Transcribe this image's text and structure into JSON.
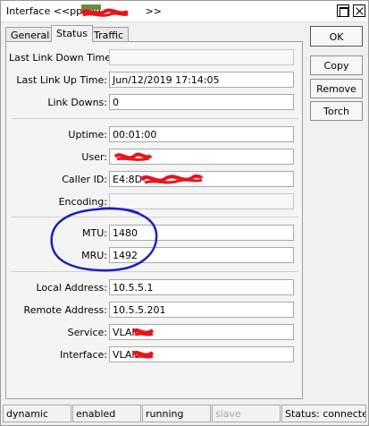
{
  "window": {
    "title": "Interface <<pppoe-",
    "title_suffix": ">>"
  },
  "tabs": [
    {
      "label": "General"
    },
    {
      "label": "Status"
    },
    {
      "label": "Traffic"
    }
  ],
  "fields": {
    "last_link_down_time": {
      "label": "Last Link Down Time:",
      "value": ""
    },
    "last_link_up_time": {
      "label": "Last Link Up Time:",
      "value": "Jun/12/2019 17:14:05"
    },
    "link_downs": {
      "label": "Link Downs:",
      "value": "0"
    },
    "uptime": {
      "label": "Uptime:",
      "value": "00:01:00"
    },
    "user": {
      "label": "User:",
      "value": ""
    },
    "caller_id": {
      "label": "Caller ID:",
      "value": "E4:8D-"
    },
    "encoding": {
      "label": "Encoding:",
      "value": ""
    },
    "mtu": {
      "label": "MTU:",
      "value": "1480"
    },
    "mru": {
      "label": "MRU:",
      "value": "1492"
    },
    "local_address": {
      "label": "Local Address:",
      "value": "10.5.5.1"
    },
    "remote_address": {
      "label": "Remote Address:",
      "value": "10.5.5.201"
    },
    "service": {
      "label": "Service:",
      "value": "VLAN"
    },
    "interface": {
      "label": "Interface:",
      "value": "VLAN"
    }
  },
  "buttons": {
    "ok": "OK",
    "copy": "Copy",
    "remove": "Remove",
    "torch": "Torch"
  },
  "statusbar": {
    "dynamic": "dynamic",
    "enabled": "enabled",
    "running": "running",
    "slave": "slave",
    "status": "Status: connected"
  },
  "colors": {
    "redaction": "#e8141c",
    "annotation": "#1a1fbf"
  }
}
